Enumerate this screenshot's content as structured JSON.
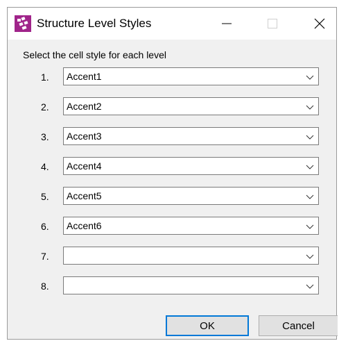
{
  "window": {
    "title": "Structure Level Styles",
    "icon": "structure-app-icon",
    "controls": {
      "minimize_icon": "minimize-icon",
      "maximize_icon": "maximize-icon",
      "close_icon": "close-icon"
    }
  },
  "prompt": "Select the cell style for each level",
  "levels": [
    {
      "number": "1.",
      "value": "Accent1"
    },
    {
      "number": "2.",
      "value": "Accent2"
    },
    {
      "number": "3.",
      "value": "Accent3"
    },
    {
      "number": "4.",
      "value": "Accent4"
    },
    {
      "number": "5.",
      "value": "Accent5"
    },
    {
      "number": "6.",
      "value": "Accent6"
    },
    {
      "number": "7.",
      "value": ""
    },
    {
      "number": "8.",
      "value": ""
    }
  ],
  "buttons": {
    "ok_label": "OK",
    "cancel_label": "Cancel"
  },
  "colors": {
    "icon_accent": "#a0248a",
    "focus_border": "#0078d7"
  }
}
